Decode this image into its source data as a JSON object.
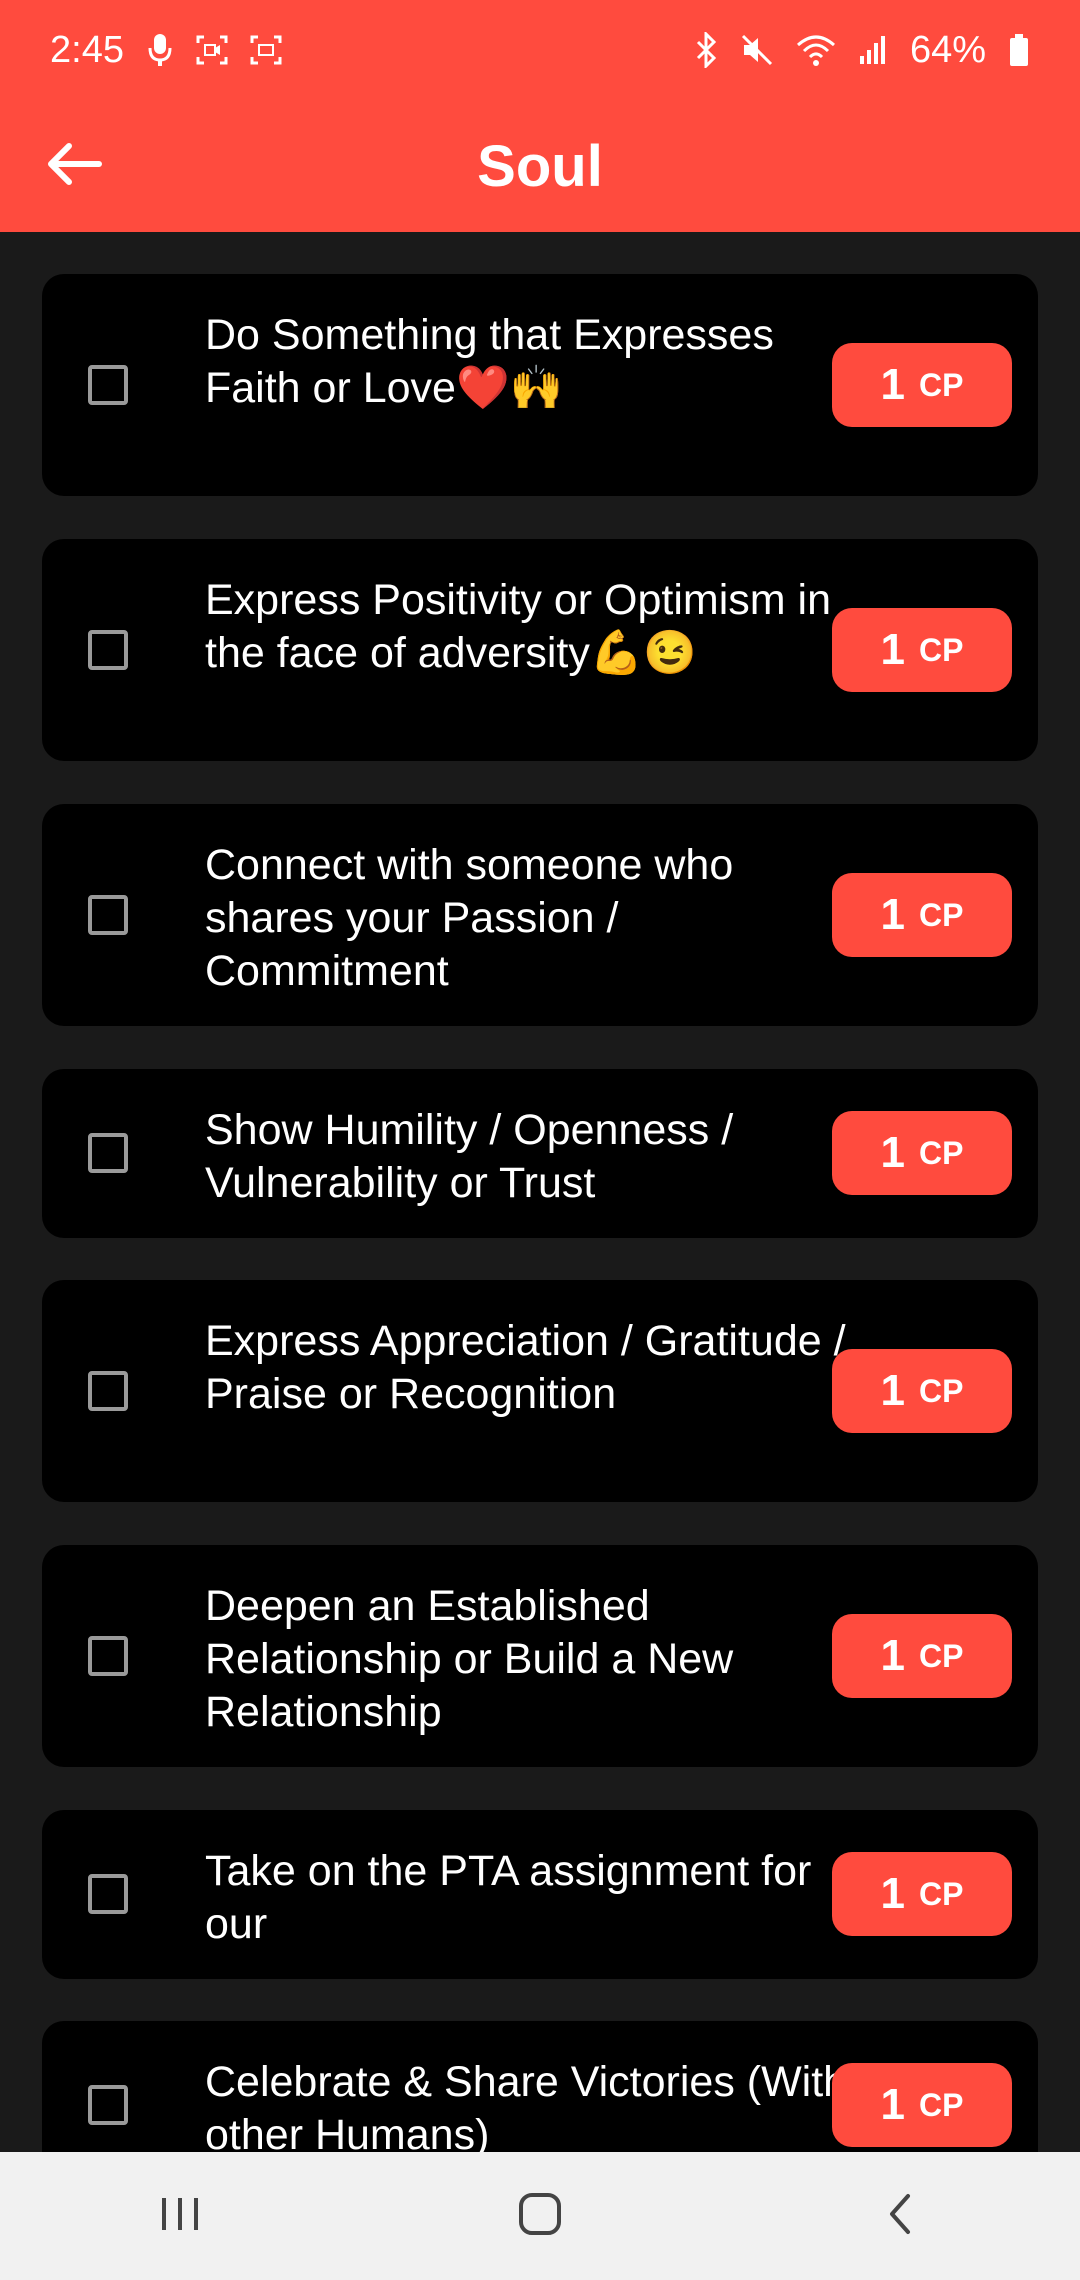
{
  "status_bar": {
    "time": "2:45",
    "battery": "64%",
    "icons": [
      "mic-icon",
      "screen-record-icon",
      "screen-capture-icon",
      "bluetooth-icon",
      "mute-icon",
      "wifi-icon",
      "signal-icon",
      "battery-icon"
    ]
  },
  "header": {
    "title": "Soul",
    "back_icon": "arrow-left-icon"
  },
  "colors": {
    "accent": "#ff4b3e",
    "background": "#1a1a1a",
    "card": "#000000"
  },
  "tasks": [
    {
      "text": "Do Something that Expresses Faith or Love❤️🙌",
      "points": "1",
      "unit": "CP",
      "checked": false
    },
    {
      "text": "Express Positivity or Optimism in the face of adversity💪😉",
      "points": "1",
      "unit": "CP",
      "checked": false
    },
    {
      "text": "Connect with someone who shares your Passion / Commitment",
      "points": "1",
      "unit": "CP",
      "checked": false
    },
    {
      "text": "Show Humility / Openness / Vulnerability or Trust",
      "points": "1",
      "unit": "CP",
      "checked": false
    },
    {
      "text": "Express Appreciation / Gratitude / Praise or Recognition",
      "points": "1",
      "unit": "CP",
      "checked": false
    },
    {
      "text": "Deepen an Established Relationship or Build a New Relationship",
      "points": "1",
      "unit": "CP",
      "checked": false
    },
    {
      "text": "Take on the PTA assignment for our",
      "points": "1",
      "unit": "CP",
      "checked": false
    },
    {
      "text": "Celebrate & Share Victories (With other Humans)",
      "points": "1",
      "unit": "CP",
      "checked": false
    }
  ],
  "nav_bar": {
    "items": [
      "recent-apps-icon",
      "home-icon",
      "back-icon"
    ]
  }
}
